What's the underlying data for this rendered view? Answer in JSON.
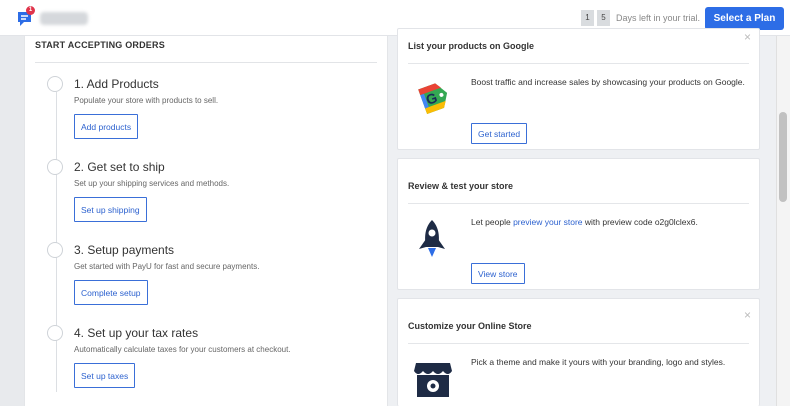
{
  "topbar": {
    "notification_count": "1",
    "trial_digits": [
      "1",
      "5"
    ],
    "trial_text": "Days left in your trial.",
    "plan_button": "Select a Plan"
  },
  "orders": {
    "title": "START ACCEPTING ORDERS",
    "steps": [
      {
        "title": "1. Add Products",
        "desc": "Populate your store with products to sell.",
        "button": "Add products"
      },
      {
        "title": "2. Get set to ship",
        "desc": "Set up your shipping services and methods.",
        "button": "Set up shipping"
      },
      {
        "title": "3. Setup payments",
        "desc": "Get started with PayU for fast and secure payments.",
        "button": "Complete setup"
      },
      {
        "title": "4. Set up your tax rates",
        "desc": "Automatically calculate taxes for your customers at checkout.",
        "button": "Set up taxes"
      }
    ]
  },
  "cards": {
    "google": {
      "title": "List your products on Google",
      "text": "Boost traffic and increase sales by showcasing your products on Google.",
      "button": "Get started",
      "close": "×"
    },
    "review": {
      "title": "Review & test your store",
      "text_before": "Let people ",
      "link": "preview your store",
      "text_after": " with preview code o2g0lclex6.",
      "button": "View store"
    },
    "customize": {
      "title": "Customize your Online Store",
      "text": "Pick a theme and make it yours with your branding, logo and styles.",
      "close": "×"
    }
  },
  "colors": {
    "accent": "#2d6de6",
    "badge": "#e0344b"
  },
  "icons": [
    "bigcommerce-logo-icon",
    "google-tag-icon",
    "rocket-icon",
    "storefront-gear-icon",
    "close-icon"
  ]
}
